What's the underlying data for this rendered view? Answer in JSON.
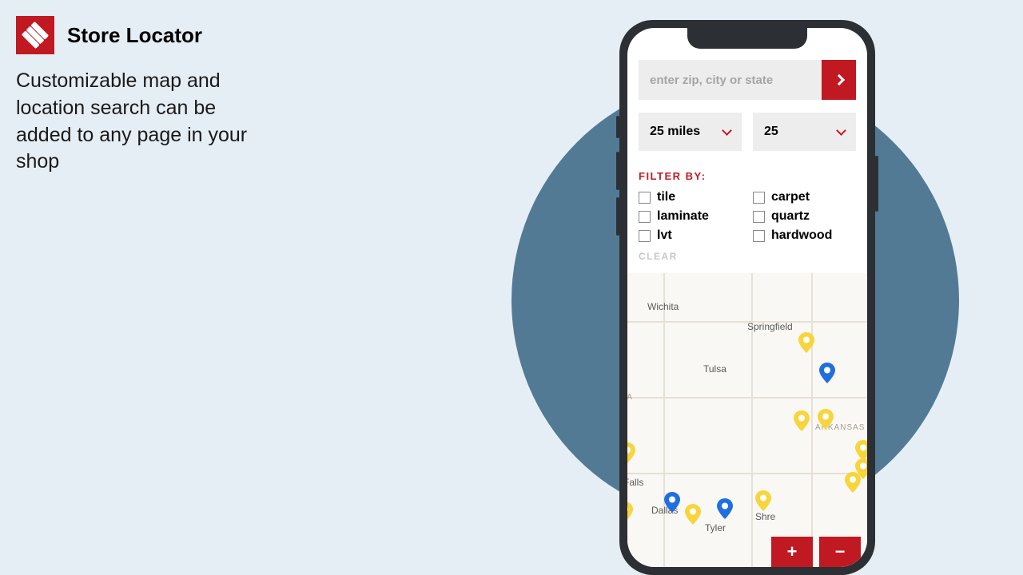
{
  "header": {
    "title": "Store Locator"
  },
  "description": "Customizable map and location search can be added to any page in your shop",
  "search": {
    "placeholder": "enter zip, city or state"
  },
  "selects": {
    "radius": "25 miles",
    "results": "25"
  },
  "filters": {
    "title": "FILTER BY:",
    "items": [
      "tile",
      "carpet",
      "laminate",
      "quartz",
      "lvt",
      "hardwood"
    ],
    "clear": "CLEAR"
  },
  "map": {
    "cities": {
      "wichita": "Wichita",
      "springfield": "Springfield",
      "tulsa": "Tulsa",
      "falls": "Falls",
      "dallas": "Dallas",
      "tyler": "Tyler",
      "shreve": "Shre"
    },
    "states": {
      "ma": "MA",
      "arkansas": "ARKANSAS"
    }
  },
  "zoom": {
    "in": "+",
    "out": "−"
  }
}
